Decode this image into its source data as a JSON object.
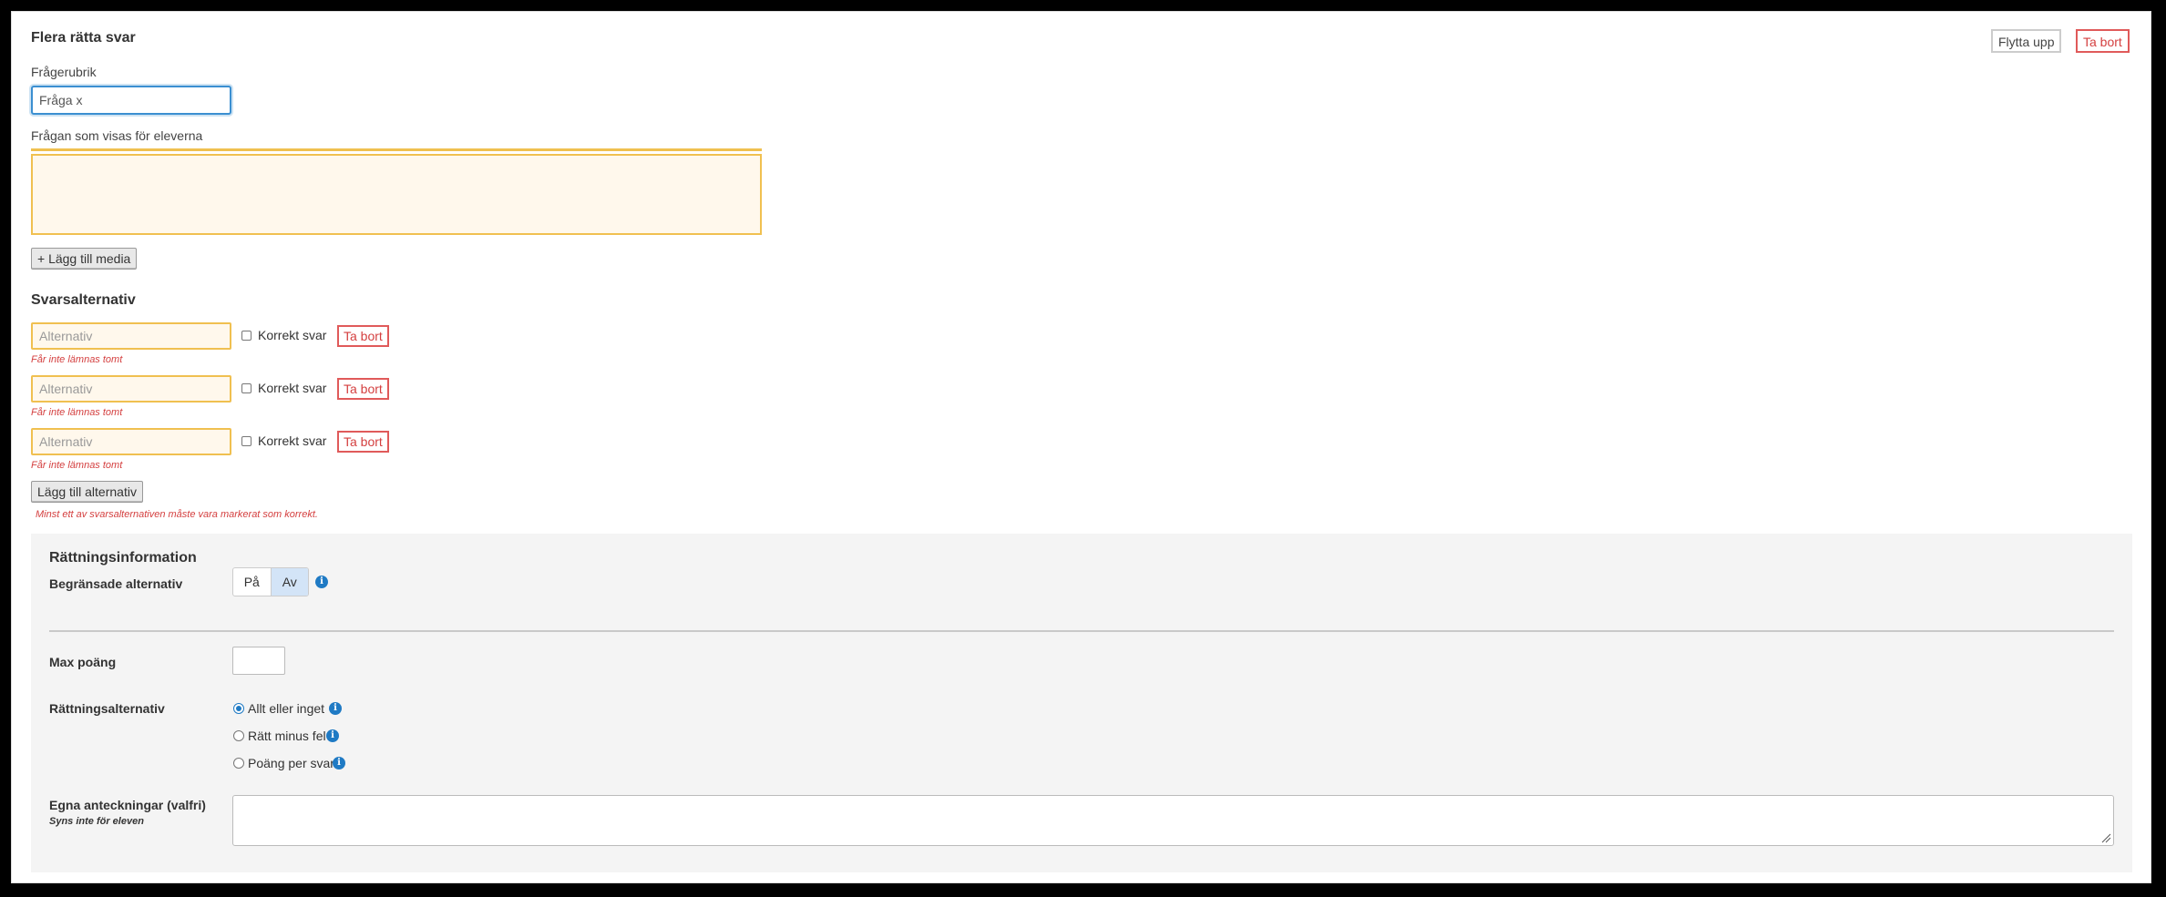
{
  "question": {
    "type_heading": "Flera rätta svar",
    "move_up_label": "Flytta upp",
    "delete_label": "Ta bort",
    "title_label": "Frågerubrik",
    "title_value": "Fråga x",
    "prompt_label": "Frågan som visas för eleverna",
    "add_media_label": "+ Lägg till media"
  },
  "answers": {
    "heading": "Svarsalternativ",
    "placeholder": "Alternativ",
    "correct_label": "Korrekt svar",
    "delete_label": "Ta bort",
    "empty_error": "Får inte lämnas tomt",
    "items": [
      {
        "value": "",
        "correct": false
      },
      {
        "value": "",
        "correct": false
      },
      {
        "value": "",
        "correct": false
      }
    ],
    "add_label": "Lägg till alternativ",
    "min_correct_error": "Minst ett av svarsalternativen måste vara markerat som korrekt."
  },
  "grading": {
    "heading": "Rättningsinformation",
    "limited_label": "Begränsade alternativ",
    "on_label": "På",
    "off_label": "Av",
    "selected": "Av",
    "max_points_label": "Max poäng",
    "max_points_value": "",
    "scoring_label": "Rättningsalternativ",
    "scoring_options": [
      {
        "label": "Allt eller inget",
        "checked": true
      },
      {
        "label": "Rätt minus fel",
        "checked": false
      },
      {
        "label": "Poäng per svar",
        "checked": false
      }
    ],
    "notes_label": "Egna anteckningar (valfri)",
    "notes_hint": "Syns inte för eleven"
  },
  "colors": {
    "accent": "#1f7ac4",
    "error": "#d43f3f",
    "warning_border": "#f0c050",
    "warning_fill": "#fff8ec"
  },
  "icons": [
    "info-icon",
    "resize-grip-icon"
  ]
}
